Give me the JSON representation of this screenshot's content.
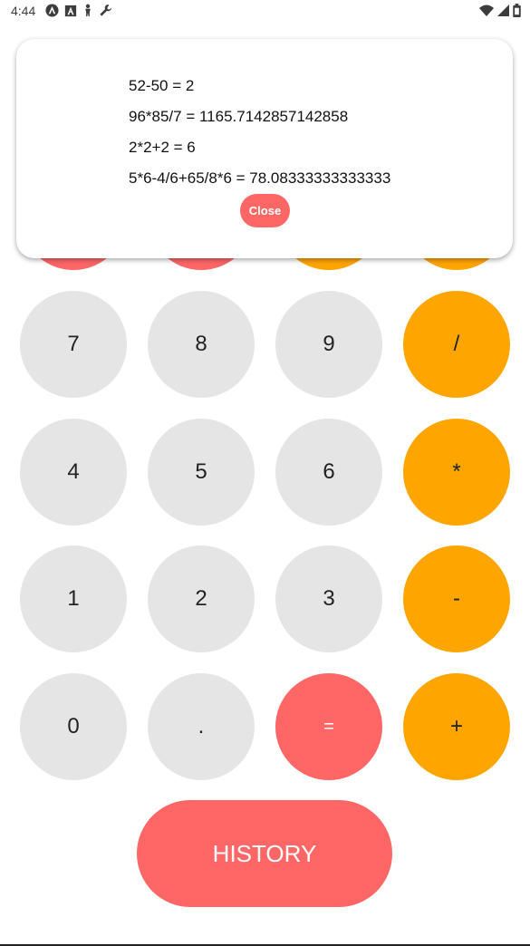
{
  "status_bar": {
    "time": "4:44",
    "left_icons": [
      "android-auto-icon",
      "a-box-icon",
      "accessibility-icon",
      "wrench-icon"
    ],
    "right_icons": [
      "wifi-icon",
      "signal-icon",
      "battery-icon"
    ]
  },
  "keypad": {
    "rows": [
      [
        {
          "label": "7",
          "kind": "num"
        },
        {
          "label": "8",
          "kind": "num"
        },
        {
          "label": "9",
          "kind": "num"
        },
        {
          "label": "/",
          "kind": "op"
        }
      ],
      [
        {
          "label": "4",
          "kind": "num"
        },
        {
          "label": "5",
          "kind": "num"
        },
        {
          "label": "6",
          "kind": "num"
        },
        {
          "label": "*",
          "kind": "op"
        }
      ],
      [
        {
          "label": "1",
          "kind": "num"
        },
        {
          "label": "2",
          "kind": "num"
        },
        {
          "label": "3",
          "kind": "num"
        },
        {
          "label": "-",
          "kind": "op"
        }
      ],
      [
        {
          "label": "0",
          "kind": "num"
        },
        {
          "label": ".",
          "kind": "num"
        },
        {
          "label": "=",
          "kind": "eq"
        },
        {
          "label": "+",
          "kind": "op"
        }
      ]
    ]
  },
  "history_button": {
    "label": "HISTORY"
  },
  "history_modal": {
    "entries": [
      "52-50 = 2",
      "96*85/7 = 1165.7142857142858",
      "2*2+2 = 6",
      "5*6-4/6+65/8*6 = 78.08333333333333"
    ],
    "close_label": "Close"
  },
  "colors": {
    "number_button": "#e5e5e5",
    "operator_button": "#ffa500",
    "accent_red": "#ff6767"
  }
}
